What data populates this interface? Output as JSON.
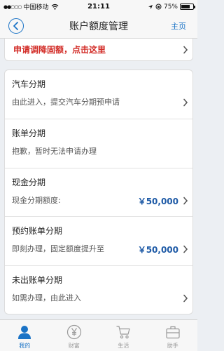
{
  "status_bar": {
    "carrier": "中国移动",
    "time": "21:11",
    "battery": "75%",
    "battery_level": 0.75
  },
  "nav": {
    "title": "账户额度管理",
    "home_label": "主页"
  },
  "banner": {
    "text": "申请调降固额，点击这里"
  },
  "items": [
    {
      "title": "汽车分期",
      "subtitle": "由此进入，提交汽车分期预申请",
      "amount": ""
    },
    {
      "title": "账单分期",
      "subtitle": "抱歉，暂时无法申请办理",
      "amount": ""
    },
    {
      "title": "现金分期",
      "subtitle": "现金分期额度:",
      "amount": "￥50,000"
    },
    {
      "title": "预约账单分期",
      "subtitle": "即刻办理，固定额度提升至",
      "amount": "￥50,000"
    },
    {
      "title": "未出账单分期",
      "subtitle": "如需办理，由此进入",
      "amount": ""
    }
  ],
  "tabs": [
    {
      "label": "我的",
      "icon": "person-icon",
      "active": true
    },
    {
      "label": "财富",
      "icon": "yen-coin-icon",
      "active": false
    },
    {
      "label": "生活",
      "icon": "shopping-cart-icon",
      "active": false
    },
    {
      "label": "助手",
      "icon": "briefcase-icon",
      "active": false
    }
  ],
  "colors": {
    "accent": "#1a73c6",
    "alert": "#d22b26",
    "amount": "#1e5aa6"
  }
}
